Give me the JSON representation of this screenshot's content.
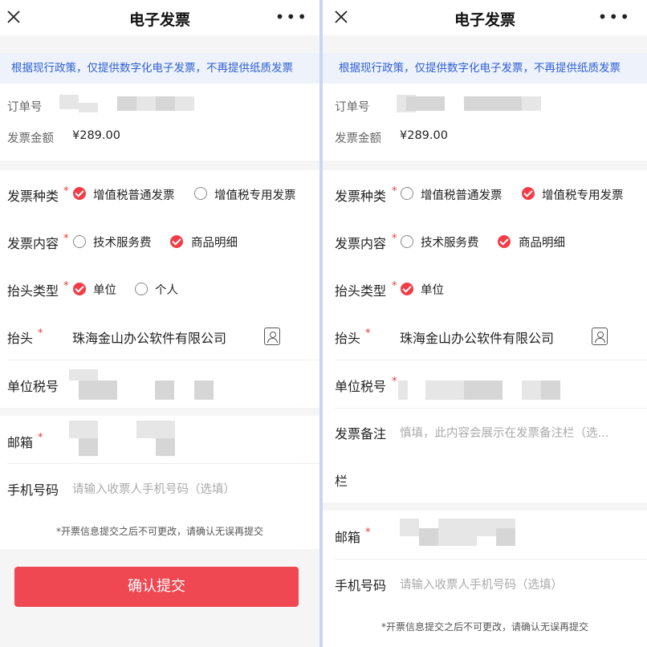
{
  "left": {
    "title": "电子发票",
    "notice": "根据现行政策，仅提供数字化电子发票，不再提供纸质发票",
    "order_label": "订单号",
    "amount_label": "发票金额",
    "amount_value": "¥289.00",
    "invoice_type_label": "发票种类",
    "invoice_type_opt1": "增值税普通发票",
    "invoice_type_opt2": "增值税专用发票",
    "invoice_type_selected": "增值税普通发票",
    "content_label": "发票内容",
    "content_opt1": "技术服务费",
    "content_opt2": "商品明细",
    "content_selected": "商品明细",
    "header_type_label": "抬头类型",
    "header_type_opt1": "单位",
    "header_type_opt2": "个人",
    "header_type_selected": "单位",
    "header_label": "抬头",
    "header_value": "珠海金山办公软件有限公司",
    "tax_label": "单位税号",
    "email_label": "邮箱",
    "phone_label": "手机号码",
    "phone_placeholder": "请输入收票人手机号码（选填）",
    "tip": "*开票信息提交之后不可更改，请确认无误再提交",
    "submit_label": "确认提交"
  },
  "right": {
    "title": "电子发票",
    "notice": "根据现行政策，仅提供数字化电子发票，不再提供纸质发票",
    "order_label": "订单号",
    "amount_label": "发票金额",
    "amount_value": "¥289.00",
    "invoice_type_label": "发票种类",
    "invoice_type_opt1": "增值税普通发票",
    "invoice_type_opt2": "增值税专用发票",
    "invoice_type_selected": "增值税专用发票",
    "content_label": "发票内容",
    "content_opt1": "技术服务费",
    "content_opt2": "商品明细",
    "content_selected": "商品明细",
    "header_type_label": "抬头类型",
    "header_type_opt1": "单位",
    "header_type_selected": "单位",
    "header_label": "抬头",
    "header_value": "珠海金山办公软件有限公司",
    "tax_label": "单位税号",
    "remark_label": "发票备注",
    "remark_placeholder": "慎填，此内容会展示在发票备注栏（选...",
    "remark_label_cont": "栏",
    "email_label": "邮箱",
    "phone_label": "手机号码",
    "phone_placeholder": "请输入收票人手机号码（选填）",
    "tip": "*开票信息提交之后不可更改，请确认无误再提交"
  },
  "colors": {
    "accent": "#f23d47",
    "notice_text": "#2f5fd3",
    "notice_bg": "#edf2fb"
  },
  "icons": [
    "close-icon",
    "more-icon",
    "contact-card-icon",
    "check-icon"
  ]
}
